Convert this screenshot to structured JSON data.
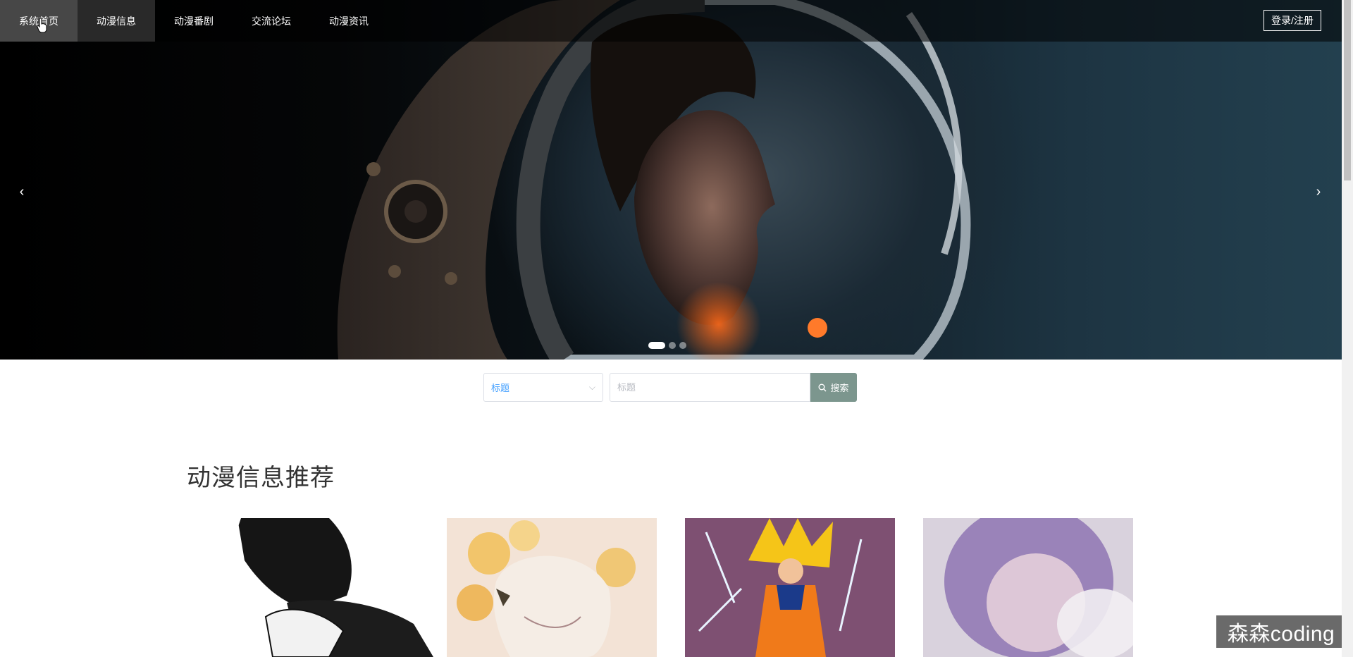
{
  "nav": {
    "items": [
      {
        "label": "系统首页"
      },
      {
        "label": "动漫信息"
      },
      {
        "label": "动漫番剧"
      },
      {
        "label": "交流论坛"
      },
      {
        "label": "动漫资讯"
      }
    ],
    "login_label": "登录/注册"
  },
  "carousel": {
    "slide_count": 3,
    "active_slide": 1
  },
  "search": {
    "select_value": "标题",
    "input_placeholder": "标题",
    "button_label": "搜索"
  },
  "section": {
    "title": "动漫信息推荐"
  },
  "watermark": "森森coding"
}
